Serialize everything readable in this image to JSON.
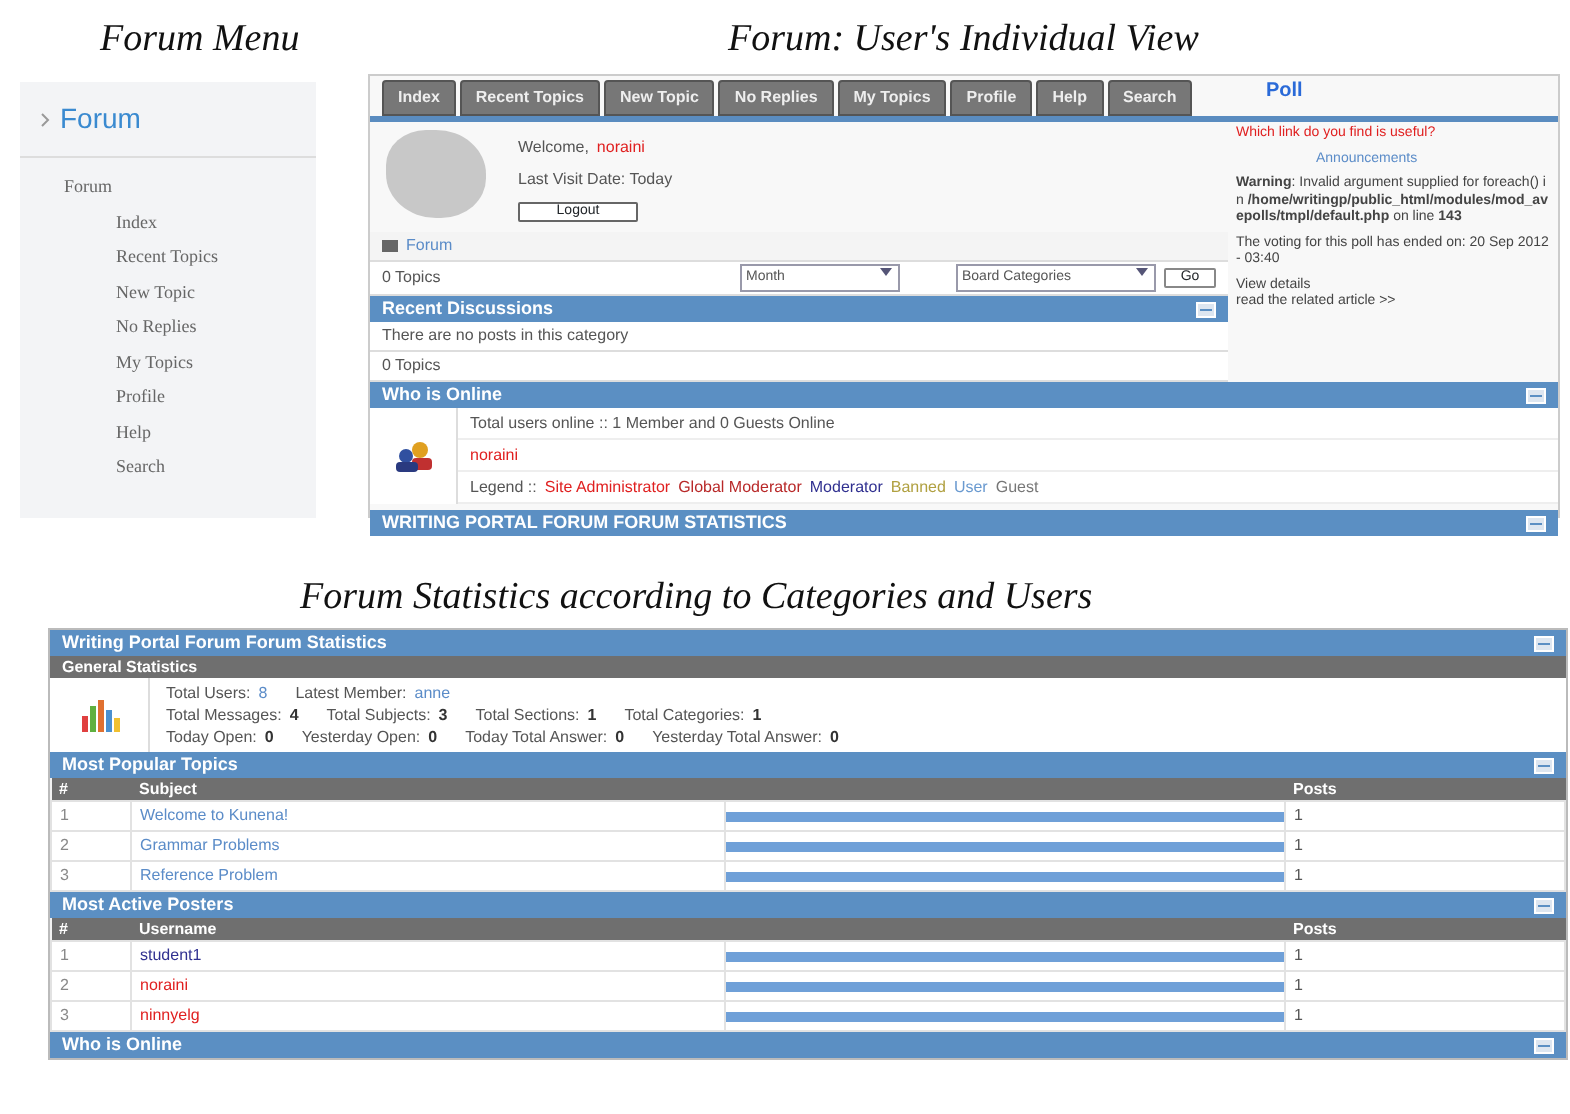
{
  "forum_menu": {
    "caption": "Forum Menu",
    "title": "Forum",
    "tree": [
      {
        "label": "Forum",
        "children": [
          {
            "label": "Index"
          },
          {
            "label": "Recent Topics"
          },
          {
            "label": "New Topic"
          },
          {
            "label": "No Replies"
          },
          {
            "label": "My Topics"
          },
          {
            "label": "Profile"
          },
          {
            "label": "Help"
          },
          {
            "label": "Search"
          }
        ]
      }
    ]
  },
  "user_view": {
    "caption": "Forum: User's Individual View",
    "tabs": [
      {
        "label": "Index"
      },
      {
        "label": "Recent Topics"
      },
      {
        "label": "New Topic"
      },
      {
        "label": "No Replies"
      },
      {
        "label": "My Topics"
      },
      {
        "label": "Profile"
      },
      {
        "label": "Help"
      },
      {
        "label": "Search"
      }
    ],
    "welcome_label": "Welcome,",
    "username": "noraini",
    "last_visit": "Last Visit Date: Today",
    "logout_button": "Logout",
    "breadcrumb": "Forum",
    "topics_label": "0 Topics",
    "month_select": "Month",
    "category_select": "Board Categories",
    "go_button": "Go",
    "recent_header": "Recent Discussions",
    "no_posts": "There are no posts in this category",
    "topics_footer": "0 Topics",
    "who_header": "Who is Online",
    "online_summary": "Total users online :: 1 Member and 0 Guests Online",
    "online_user": "noraini",
    "legend_label": "Legend ::",
    "legend": [
      {
        "label": "Site Administrator",
        "color": "#e02020"
      },
      {
        "label": "Global Moderator",
        "color": "#b82828"
      },
      {
        "label": "Moderator",
        "color": "#303090"
      },
      {
        "label": "Banned",
        "color": "#b0a040"
      },
      {
        "label": "User",
        "color": "#6a9ad0"
      },
      {
        "label": "Guest",
        "color": "#777777"
      }
    ],
    "stats_header": "WRITING PORTAL FORUM FORUM STATISTICS",
    "poll": {
      "title": "Poll",
      "question": "Which link do you find is useful?",
      "announcements": "Announcements",
      "warning": "**Warning**: Invalid argument supplied for foreach() in **/home/writingp/public_html/modules/mod_avepolls/tmpl/default.php** on line **143**",
      "ended": "The voting for this poll has ended on: 20 Sep 2012 - 03:40",
      "details": "View details",
      "article": "read the related article >>"
    }
  },
  "statistics": {
    "caption": "Forum Statistics according to Categories and Users",
    "title": "Writing Portal Forum Forum Statistics",
    "general_header": "General Statistics",
    "lines": [
      [
        {
          "label": "Total Users:",
          "value": "8"
        },
        {
          "label": "Latest Member:",
          "value": "anne"
        }
      ],
      [
        {
          "label": "Total Messages:",
          "value": "4"
        },
        {
          "label": "Total Subjects:",
          "value": "3"
        },
        {
          "label": "Total Sections:",
          "value": "1"
        },
        {
          "label": "Total Categories:",
          "value": "1"
        }
      ],
      [
        {
          "label": "Today Open:",
          "value": "0"
        },
        {
          "label": "Yesterday Open:",
          "value": "0"
        },
        {
          "label": "Today Total Answer:",
          "value": "0"
        },
        {
          "label": "Yesterday Total Answer:",
          "value": "0"
        }
      ]
    ],
    "tables": [
      {
        "title": "Most Popular Topics",
        "columns": [
          "#",
          "Subject",
          "Posts"
        ],
        "rows": [
          {
            "num": "1",
            "name": "Welcome to Kunena!",
            "color": "#5b8cc8",
            "level": 1,
            "posts": "1"
          },
          {
            "num": "2",
            "name": "Grammar Problems",
            "color": "#5b8cc8",
            "level": 1,
            "posts": "1"
          },
          {
            "num": "3",
            "name": "Reference Problem",
            "color": "#5b8cc8",
            "level": 1,
            "posts": "1"
          }
        ]
      },
      {
        "title": "Most Active Posters",
        "columns": [
          "#",
          "Username",
          "Posts"
        ],
        "rows": [
          {
            "num": "1",
            "name": "student1",
            "color": "#303090",
            "level": 1,
            "posts": "1"
          },
          {
            "num": "2",
            "name": "noraini",
            "color": "#e02020",
            "level": 1,
            "posts": "1"
          },
          {
            "num": "3",
            "name": "ninnyelg",
            "color": "#e02020",
            "level": 1,
            "posts": "1"
          }
        ]
      }
    ],
    "who_header": "Who is Online"
  }
}
